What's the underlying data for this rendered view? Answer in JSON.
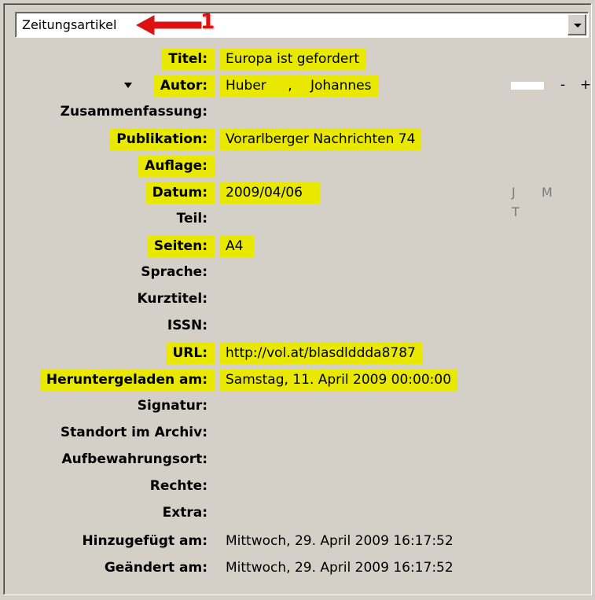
{
  "item_type": {
    "selected": "Zeitungsartikel"
  },
  "annotation": {
    "number": "1",
    "color": "#e01010"
  },
  "highlight_color": "#e8e800",
  "fields": {
    "title": {
      "label": "Titel:",
      "value": "Europa ist gefordert"
    },
    "author": {
      "label": "Autor:",
      "last": "Huber",
      "sep": ",",
      "first": "Johannes",
      "minus": "-",
      "plus": "+"
    },
    "abstract": {
      "label": "Zusammenfassung:",
      "value": ""
    },
    "publication": {
      "label": "Publikation:",
      "value": "Vorarlberger Nachrichten 74"
    },
    "edition": {
      "label": "Auflage:",
      "value": ""
    },
    "date": {
      "label": "Datum:",
      "value": "2009/04/06",
      "order_j": "J",
      "order_m": "M",
      "order_t": "T"
    },
    "section": {
      "label": "Teil:",
      "value": ""
    },
    "pages": {
      "label": "Seiten:",
      "value": "A4"
    },
    "language": {
      "label": "Sprache:",
      "value": ""
    },
    "short_title": {
      "label": "Kurztitel:",
      "value": ""
    },
    "issn": {
      "label": "ISSN:",
      "value": ""
    },
    "url": {
      "label": "URL:",
      "value": "http://vol.at/blasdlddda8787"
    },
    "accessed": {
      "label": "Heruntergeladen am:",
      "value": "Samstag, 11. April 2009 00:00:00"
    },
    "call_number": {
      "label": "Signatur:",
      "value": ""
    },
    "archive_location": {
      "label": "Standort im Archiv:",
      "value": ""
    },
    "library_catalog": {
      "label": "Aufbewahrungsort:",
      "value": ""
    },
    "rights": {
      "label": "Rechte:",
      "value": ""
    },
    "extra": {
      "label": "Extra:",
      "value": ""
    },
    "date_added": {
      "label": "Hinzugefügt am:",
      "value": "Mittwoch, 29. April 2009 16:17:52"
    },
    "date_modified": {
      "label": "Geändert am:",
      "value": "Mittwoch, 29. April 2009 16:17:52"
    }
  }
}
